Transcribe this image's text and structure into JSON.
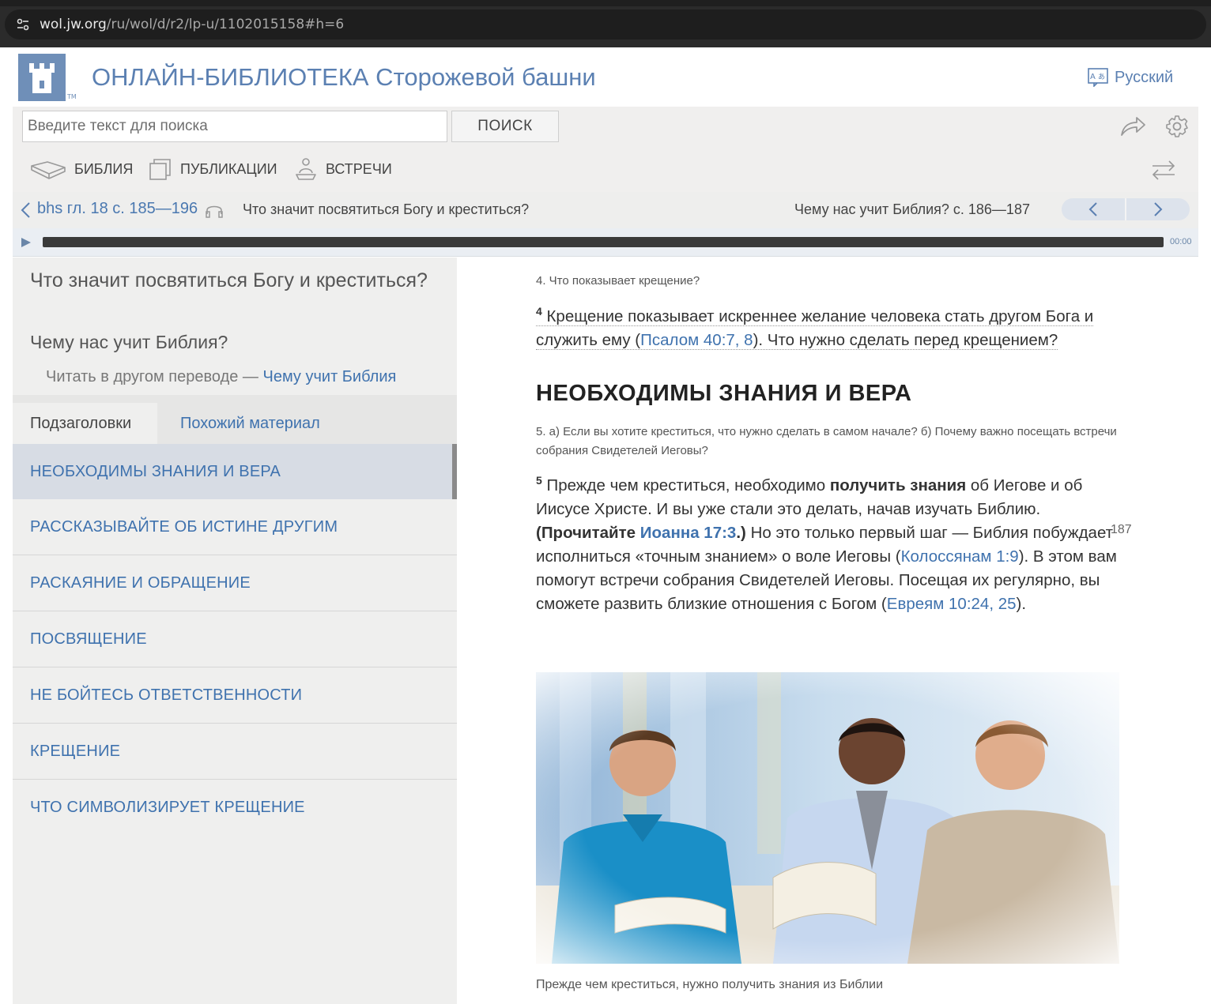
{
  "browser": {
    "url_host": "wol.jw.org",
    "url_path": "/ru/wol/d/r2/lp-u/1102015158#h=6"
  },
  "header": {
    "site_title": "ОНЛАЙН-БИБЛИОТЕКА Сторожевой башни",
    "logo_tm": "TM",
    "language": "Русский"
  },
  "search": {
    "placeholder": "Введите текст для поиска",
    "value": "",
    "button_label": "ПОИСК"
  },
  "nav": {
    "items": [
      {
        "label": "БИБЛИЯ",
        "icon": "bible-book-icon"
      },
      {
        "label": "ПУБЛИКАЦИИ",
        "icon": "publications-icon"
      },
      {
        "label": "ВСТРЕЧИ",
        "icon": "meetings-icon"
      }
    ]
  },
  "breadcrumb": {
    "ref": "bhs гл. 18 с. 185—196",
    "title": "Что значит посвятиться Богу и креститься?",
    "pages": "Чему нас учит Библия? с. 186—187"
  },
  "audio": {
    "time": "00:00"
  },
  "sidebar": {
    "title": "Что значит посвятиться Богу и креститься?",
    "subtitle": "Чему нас учит Библия?",
    "other_prefix": "Читать в другом переводе —",
    "other_link": "Чему учит Библия",
    "tabs": [
      {
        "label": "Подзаголовки"
      },
      {
        "label": "Похожий материал"
      }
    ],
    "items": [
      {
        "label": "НЕОБХОДИМЫ ЗНАНИЯ И ВЕРА"
      },
      {
        "label": "РАССКАЗЫВАЙТЕ ОБ ИСТИНЕ ДРУГИМ"
      },
      {
        "label": "РАСКАЯНИЕ И ОБРАЩЕНИЕ"
      },
      {
        "label": "ПОСВЯЩЕНИЕ"
      },
      {
        "label": "НЕ БОЙТЕСЬ ОТВЕТСТВЕННОСТИ"
      },
      {
        "label": "КРЕЩЕНИЕ"
      },
      {
        "label": "ЧТО СИМВОЛИЗИРУЕТ КРЕЩЕНИЕ"
      }
    ]
  },
  "content": {
    "q4": "4. Что показывает крещение?",
    "p4": {
      "num": "4",
      "text1": " Крещение показывает искреннее желание человека стать другом Бога и служить ему (",
      "link1": "Псалом 40:7, 8",
      "text2": "). Что нужно сделать перед крещением?"
    },
    "heading": "НЕОБХОДИМЫ ЗНАНИЯ И ВЕРА",
    "q5": "5. а) Если вы хотите креститься, что нужно сделать в самом начале? б) Почему важно посещать встречи собрания Свидетелей Иеговы?",
    "p5": {
      "num": "5",
      "text1": " Прежде чем креститься, необходимо ",
      "bold1": "получить знания",
      "text2": " об Иегове и об Иисусе Христе. И вы уже стали это делать, начав изучать Библию. ",
      "bold_open": "(Прочитайте ",
      "link_bold": "Иоанна 17:3",
      "bold_close": ".)",
      "text3": " Но это только первый шаг — Библия побуждает исполниться «точным знанием» о воле Иеговы (",
      "link2": "Колоссянам 1:9",
      "text4": "). В этом вам помогут встречи собрания Свидетелей Иеговы. Посещая их регулярно, вы сможете развить близкие отношения с Богом (",
      "link3": "Евреям 10:24, 25",
      "text5": ")."
    },
    "page_number": "187",
    "caption": "Прежде чем креститься, нужно получить знания из Библии"
  },
  "colors": {
    "brand_blue": "#5b80b2",
    "link_blue": "#3f72ae",
    "active_item_bg": "#d7dce4"
  }
}
